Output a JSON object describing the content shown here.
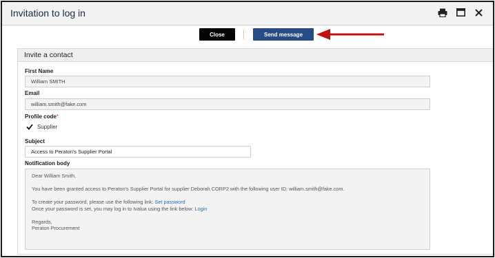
{
  "window": {
    "title": "Invitation to log in",
    "icons": [
      "print-icon",
      "maximize-icon",
      "close-icon"
    ]
  },
  "toolbar": {
    "close_label": "Close",
    "send_label": "Send message"
  },
  "annotation": {
    "arrow_color": "#c01010"
  },
  "section": {
    "title": "Invite a contact"
  },
  "form": {
    "first_name_label": "First Name",
    "first_name_value": "William SMITH",
    "email_label": "Email",
    "email_value": "william.smith@fake.com",
    "profile_code_label": "Profile code",
    "profile_code_required": "*",
    "profile_option": "Supplier",
    "profile_checked": true,
    "subject_label": "Subject",
    "subject_value": "Access to Peraton's Supplier Portal",
    "body_label": "Notification body"
  },
  "notification": {
    "greeting": "Dear William Smith,",
    "line1": "You have been granted access to Peraton's Supplier Portal for supplier Deborah CORP2 with the following user ID: william.smith@fake.com.",
    "line2_prefix": "To create your password, please use the following link:",
    "line2_link": "Set password",
    "line3_prefix": "Once your password is set, you may log in to Ivalua using the link below:",
    "line3_link": "Login",
    "closing": "Regards,",
    "signature": "Peraton Procurement"
  },
  "colors": {
    "send_button": "#274b85",
    "close_button": "#050505",
    "link": "#2a6ac0",
    "required": "#d33333"
  }
}
